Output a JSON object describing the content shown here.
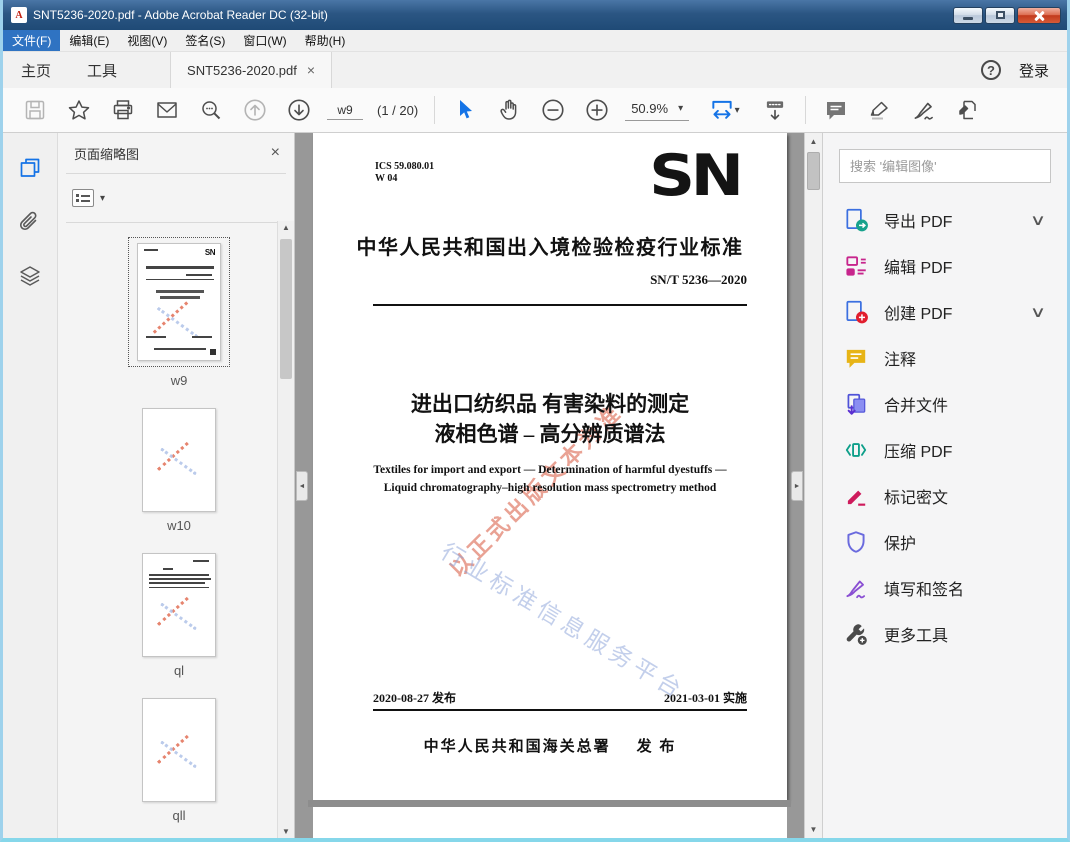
{
  "window": {
    "title": "SNT5236-2020.pdf - Adobe Acrobat Reader DC (32-bit)",
    "pdf_badge": "A"
  },
  "icons": {
    "close": "×",
    "dropdown": "▾",
    "chevron_down": "∨",
    "arrow_up": "▲",
    "arrow_down": "▼",
    "arrow_left": "◄",
    "arrow_right": "►",
    "help": "?"
  },
  "menu": {
    "items": [
      {
        "label": "文件(F)"
      },
      {
        "label": "编辑(E)"
      },
      {
        "label": "视图(V)"
      },
      {
        "label": "签名(S)"
      },
      {
        "label": "窗口(W)"
      },
      {
        "label": "帮助(H)"
      }
    ]
  },
  "tabs": {
    "home": "主页",
    "tools": "工具",
    "document": "SNT5236-2020.pdf",
    "sign_in": "登录"
  },
  "toolbar": {
    "page_field": "w9",
    "page_count": "(1 / 20)",
    "zoom_level": "50.9%"
  },
  "thumbnails": {
    "panel_title": "页面缩略图",
    "items": [
      {
        "label": "w9"
      },
      {
        "label": "w10"
      },
      {
        "label": "ql"
      },
      {
        "label": "qll"
      }
    ]
  },
  "document": {
    "ics_line1": "ICS 59.080.01",
    "ics_line2": "W 04",
    "logo": "SN",
    "standard_heading": "中华人民共和国出入境检验检疫行业标准",
    "standard_number": "SN/T 5236—2020",
    "title_line1": "进出口纺织品 有害染料的测定",
    "title_line2": "液相色谱 – 高分辨质谱法",
    "english_line1": "Textiles for import and export — Determination of harmful dyestuffs —",
    "english_line2": "Liquid chromatography–high resolution mass spectrometry method",
    "watermark_red": "以正式出版文本为准",
    "watermark_blue": "行业标准信息服务平台",
    "issue_date": "2020-08-27 发布",
    "implement_date": "2021-03-01 实施",
    "publisher": "中华人民共和国海关总署",
    "publish_label": "发 布"
  },
  "right_panel": {
    "search_placeholder": "搜索 '编辑图像'",
    "tools": [
      {
        "label": "导出 PDF"
      },
      {
        "label": "编辑 PDF"
      },
      {
        "label": "创建 PDF"
      },
      {
        "label": "注释"
      },
      {
        "label": "合并文件"
      },
      {
        "label": "压缩 PDF"
      },
      {
        "label": "标记密文"
      },
      {
        "label": "保护"
      },
      {
        "label": "填写和签名"
      },
      {
        "label": "更多工具"
      }
    ]
  },
  "colors": {
    "accent_blue": "#1473e6",
    "export_teal": "#17a28c",
    "edit_magenta": "#c7258c",
    "create_red": "#e11d2e",
    "comment_yellow": "#e7b416",
    "combine_indigo": "#5558d9",
    "compress_teal": "#0e9f8a",
    "redact_crimson": "#ce1b5c",
    "protect_periwinkle": "#6a6ade",
    "fillsign_purple": "#8a4fd3"
  }
}
